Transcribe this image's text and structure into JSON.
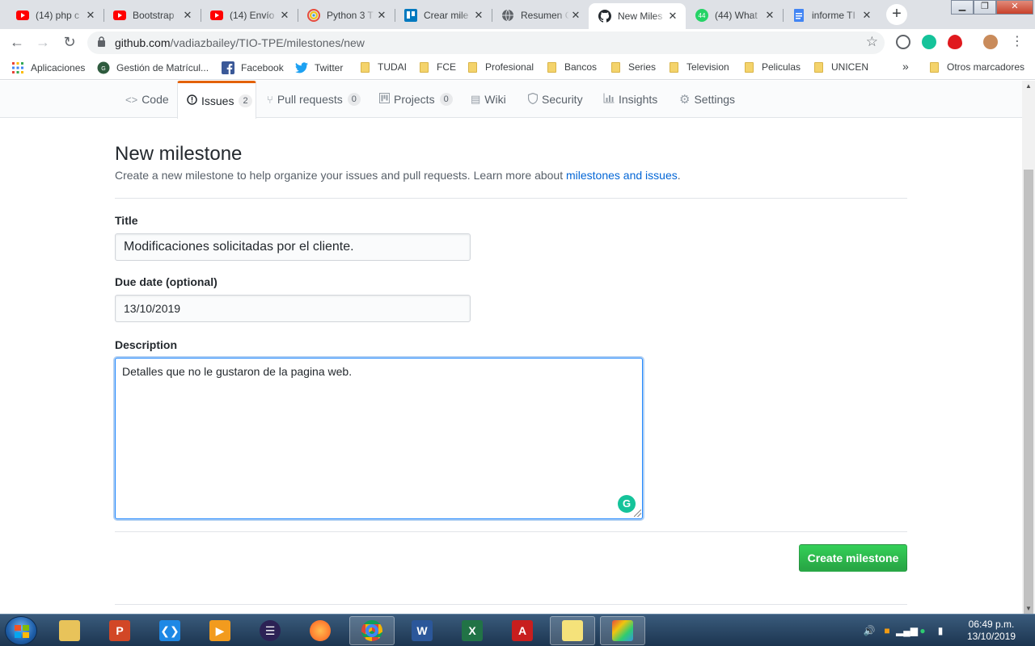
{
  "tabs": [
    {
      "title": "(14) php c",
      "icon": "youtube-icon"
    },
    {
      "title": "Bootstrap",
      "icon": "youtube-icon"
    },
    {
      "title": "(14) Envío",
      "icon": "youtube-icon"
    },
    {
      "title": "Python 3 T",
      "icon": "chrome-swirl-icon"
    },
    {
      "title": "Crear mile",
      "icon": "trello-icon"
    },
    {
      "title": "Resumen C",
      "icon": "globe-icon"
    },
    {
      "title": "New Miles",
      "icon": "github-icon",
      "active": true
    },
    {
      "title": "(44) What",
      "icon": "whatsapp-icon",
      "badge": "44"
    },
    {
      "title": "informe TI",
      "icon": "google-docs-icon"
    }
  ],
  "address": {
    "host": "github.com",
    "path": "/vadiazbailey/TIO-TPE/milestones/new"
  },
  "bookmarks": [
    {
      "label": "Aplicaciones",
      "icon": "apps-grid-icon"
    },
    {
      "label": "Gestión de Matrícul...",
      "icon": "site-icon"
    },
    {
      "label": "Facebook",
      "icon": "facebook-icon"
    },
    {
      "label": "Twitter",
      "icon": "twitter-icon"
    },
    {
      "label": "TUDAI",
      "icon": "folder-icon"
    },
    {
      "label": "FCE",
      "icon": "folder-icon"
    },
    {
      "label": "Profesional",
      "icon": "folder-icon"
    },
    {
      "label": "Bancos",
      "icon": "folder-icon"
    },
    {
      "label": "Series",
      "icon": "folder-icon"
    },
    {
      "label": "Television",
      "icon": "folder-icon"
    },
    {
      "label": "Peliculas",
      "icon": "folder-icon"
    },
    {
      "label": "UNICEN",
      "icon": "folder-icon"
    },
    {
      "label": "Otros marcadores",
      "icon": "folder-icon"
    }
  ],
  "more_bookmarks": "»",
  "reponav": {
    "code": "Code",
    "issues": "Issues",
    "issues_count": "2",
    "pulls": "Pull requests",
    "pulls_count": "0",
    "projects": "Projects",
    "projects_count": "0",
    "wiki": "Wiki",
    "security": "Security",
    "insights": "Insights",
    "settings": "Settings"
  },
  "form": {
    "heading": "New milestone",
    "subtitle": "Create a new milestone to help organize your issues and pull requests. Learn more about",
    "subtitle_link": "milestones and issues",
    "subtitle_end": ".",
    "title_label": "Title",
    "title_value": "Modificaciones solicitadas por el cliente.",
    "due_label": "Due date (optional)",
    "due_value": "13/10/2019",
    "desc_label": "Description",
    "desc_value": "Detalles que no le gustaron de la pagina web.",
    "submit": "Create milestone"
  },
  "taskbar": {
    "apps": [
      "file-explorer-icon",
      "powerpoint-icon",
      "vscode-icon",
      "media-player-icon",
      "eclipse-icon",
      "firefox-icon",
      "chrome-icon",
      "word-icon",
      "excel-icon",
      "acrobat-icon",
      "sticky-notes-icon",
      "paint-icon"
    ],
    "time": "06:49 p.m.",
    "date": "13/10/2019"
  },
  "colors": {
    "accent_tab": "#e36209",
    "link": "#0366d6",
    "create_button": "#28a745"
  }
}
